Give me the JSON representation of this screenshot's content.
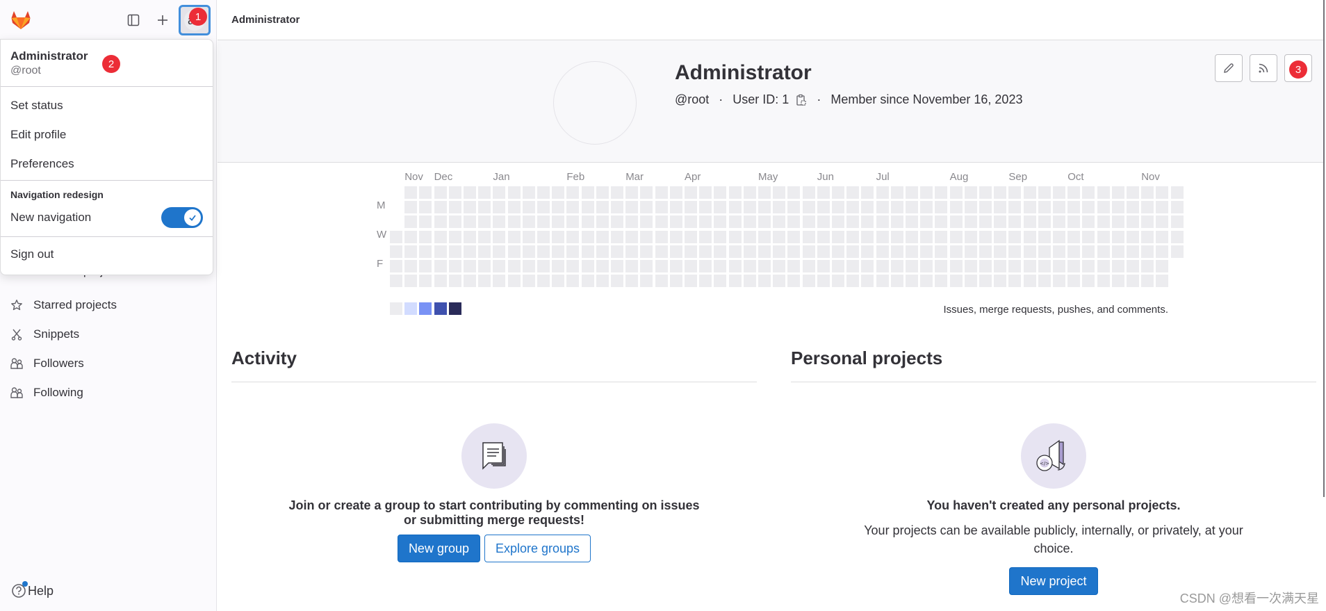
{
  "sidebar": {
    "logo": "gitlab-logo",
    "icons": [
      "sidebar-toggle-icon",
      "plus-icon"
    ],
    "avatar_letter": "a",
    "hidden_item": "Personal projects",
    "items": [
      {
        "label": "Starred projects",
        "icon": "star-icon"
      },
      {
        "label": "Snippets",
        "icon": "snippet-icon"
      },
      {
        "label": "Followers",
        "icon": "users-icon"
      },
      {
        "label": "Following",
        "icon": "users-icon"
      }
    ],
    "help_label": "Help"
  },
  "markers": {
    "one": "1",
    "two": "2",
    "three": "3"
  },
  "dropdown": {
    "name": "Administrator",
    "username": "@root",
    "items": [
      "Set status",
      "Edit profile",
      "Preferences"
    ],
    "section_title": "Navigation redesign",
    "toggle_label": "New navigation",
    "toggle_on": true,
    "sign_out": "Sign out"
  },
  "topbar": {
    "breadcrumb": "Administrator"
  },
  "profile": {
    "name": "Administrator",
    "username": "@root",
    "user_id": "User ID: 1",
    "member_since": "Member since November 16, 2023",
    "separator": "·"
  },
  "calendar": {
    "months": [
      "Nov",
      "Dec",
      "Jan",
      "Feb",
      "Mar",
      "Apr",
      "May",
      "Jun",
      "Jul",
      "Aug",
      "Sep",
      "Oct",
      "Nov"
    ],
    "day_labels": [
      "M",
      "W",
      "F"
    ],
    "legend_colors": [
      "#ececef",
      "#d2dcff",
      "#7992f5",
      "#3f51ae",
      "#2a2b59"
    ],
    "note": "Issues, merge requests, pushes, and comments.",
    "contributions": 0
  },
  "activity": {
    "title": "Activity",
    "empty_text": "Join or create a group to start contributing by commenting on issues or submitting merge requests!",
    "new_group": "New group",
    "explore_groups": "Explore groups"
  },
  "projects": {
    "title": "Personal projects",
    "empty_title": "You haven't created any personal projects.",
    "empty_desc": "Your projects can be available publicly, internally, or privately, at your choice.",
    "new_project": "New project"
  },
  "watermark": "CSDN @想看一次满天星"
}
